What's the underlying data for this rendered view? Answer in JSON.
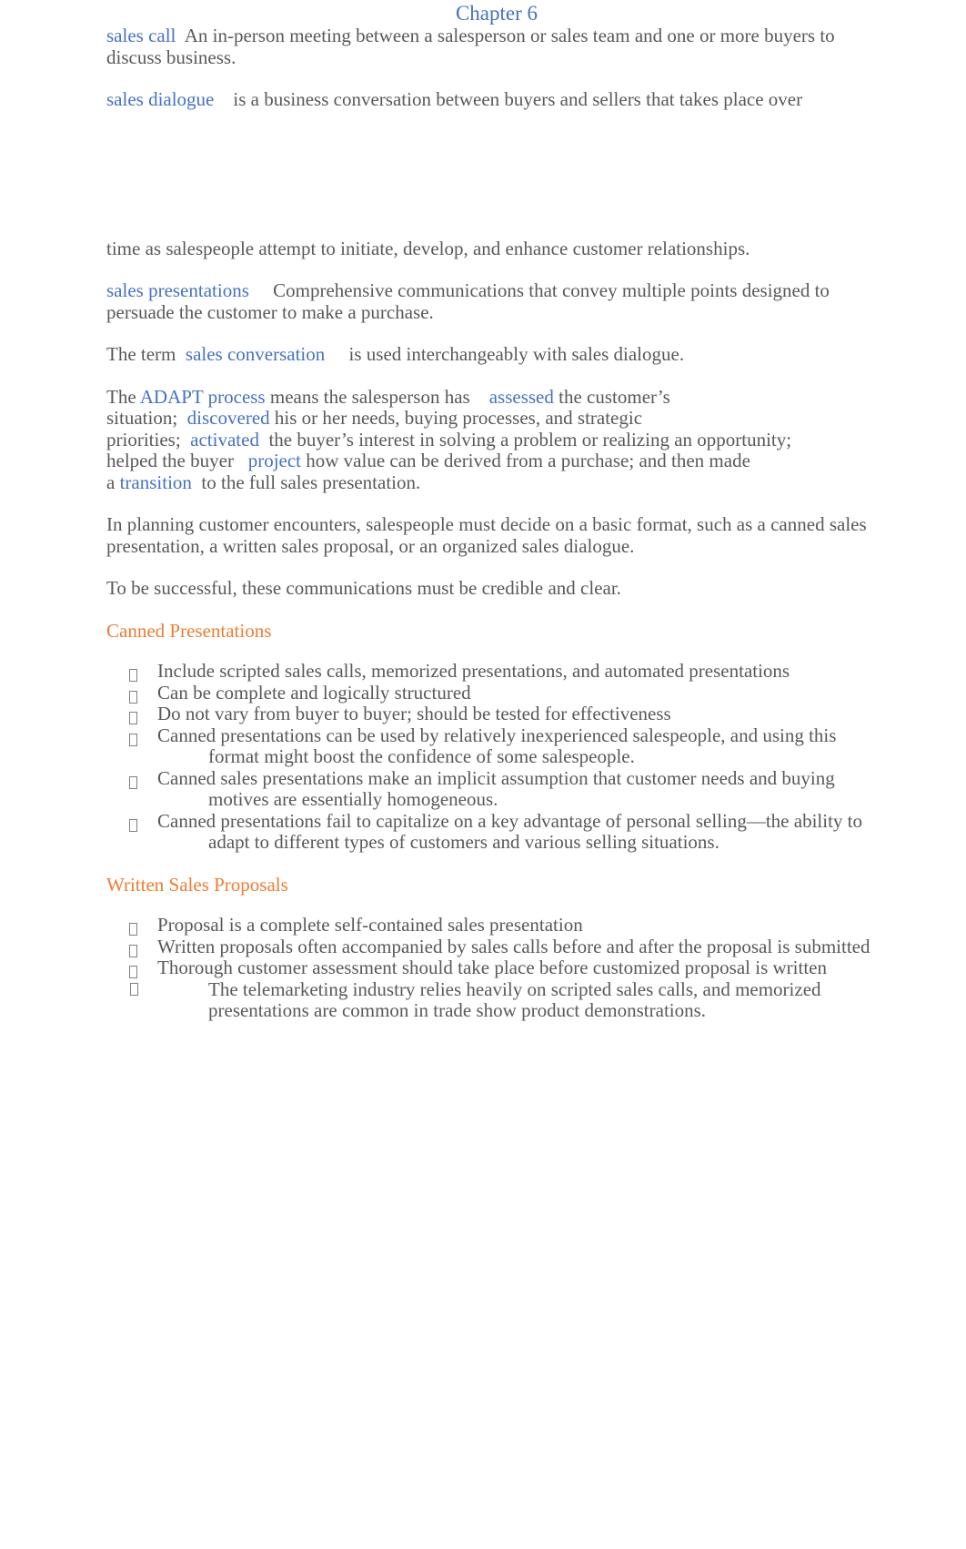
{
  "document": {
    "title": "Chapter 6",
    "title_color": "#4472C4",
    "term_color": "#4472C4",
    "heading_color": "#ED7D31",
    "body_color": "#595959",
    "bullet_glyph": "missing-glyph-box"
  },
  "entries": {
    "sales_call": {
      "term": "sales call",
      "definition": "An in-person meeting between a salesperson or sales team and one or more buyers to discuss business."
    },
    "sales_dialogue": {
      "term": "sales dialogue",
      "definition_part1": "is a business conversation between buyers and sellers that takes place over",
      "definition_part2": "time as salespeople attempt to initiate, develop, and enhance customer relationships."
    },
    "sales_presentations": {
      "term": "sales presentations",
      "definition": "Comprehensive communications that convey multiple points designed to persuade the customer to make a purchase."
    },
    "sales_conversation": {
      "lead_in": "The term",
      "term": "sales conversation",
      "tail": "is used interchangeably with sales dialogue."
    },
    "adapt_process": {
      "lead_in": "The",
      "term": "ADAPT process",
      "seg1": "means the salesperson has",
      "step1": "assessed",
      "seg2": "the customer’s",
      "line2_lead": "situation;",
      "step2": "discovered",
      "seg3": "his or her needs, buying processes, and strategic",
      "line3_lead": "priorities;",
      "step3": "activated",
      "seg4": "the buyer’s interest in solving a problem or realizing an opportunity;",
      "line4_lead": "helped the buyer",
      "step4": "project",
      "seg5": "how value can be derived from a purchase; and then made",
      "line5_lead": "a",
      "step5": "transition",
      "seg6": "to the full sales presentation."
    }
  },
  "paragraphs": {
    "planning": "In planning customer encounters, salespeople must decide on a basic format, such as a canned sales presentation, a written sales proposal, or an organized sales dialogue.",
    "credible": "To be successful, these communications must be credible and clear."
  },
  "sections": [
    {
      "heading": "Canned Presentations",
      "bullets": [
        "Include scripted sales calls, memorized presentations, and automated presentations",
        "Can be complete and logically structured",
        "Do not vary from buyer to buyer; should be tested for effectiveness",
        "Canned presentations can be used by relatively inexperienced salespeople, and using this format might boost the confidence of some salespeople.",
        "Canned sales presentations make an implicit assumption that customer needs and buying motives are essentially homogeneous.",
        "Canned presentations fail to capitalize on a key advantage of personal selling—the ability to adapt to different types of customers and various selling situations."
      ]
    },
    {
      "heading": "Written Sales Proposals",
      "bullets": [
        "Proposal is a complete self-contained sales presentation",
        "Written proposals often accompanied by sales calls before and after the proposal is submitted",
        "Thorough customer assessment should take place before customized proposal is written"
      ],
      "sub_bullets": [
        "The telemarketing industry relies heavily on scripted sales calls, and memorized presentations are common in trade show product demonstrations."
      ]
    }
  ]
}
